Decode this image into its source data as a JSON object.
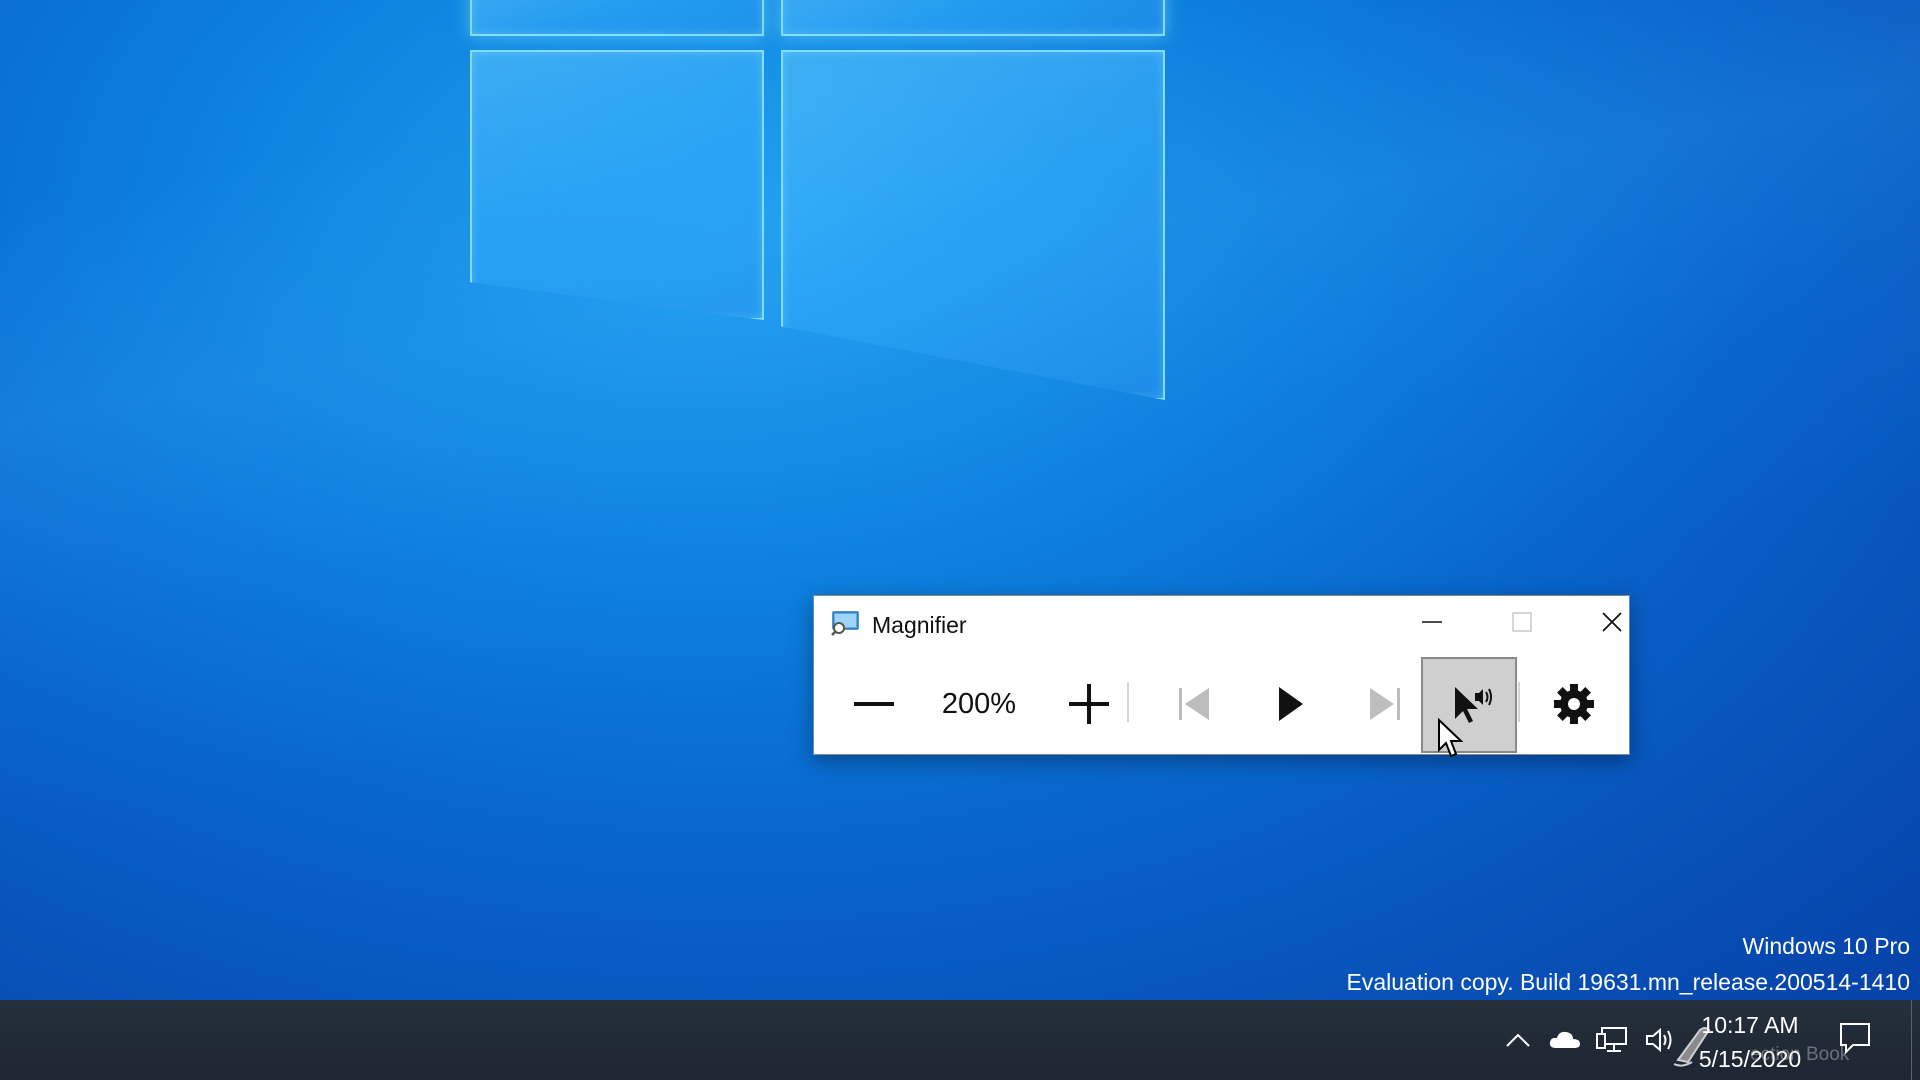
{
  "desktop": {
    "watermark_edition": "Windows 10 Pro",
    "watermark_build": "Evaluation copy. Build 19631.mn_release.200514-1410"
  },
  "magnifier": {
    "title": "Magnifier",
    "zoom_level": "200%",
    "buttons": {
      "zoom_out": "zoom-out-icon",
      "zoom_in": "zoom-in-icon",
      "previous": "skip-back-icon",
      "play": "play-icon",
      "next": "skip-forward-icon",
      "read_from_cursor": "read-from-cursor-icon",
      "settings": "gear-icon"
    },
    "active_button": "read_from_cursor"
  },
  "taskbar": {
    "time": "10:17 AM",
    "date": "5/15/2020",
    "overlay_text": "ection Book",
    "tray_icons": [
      "chevron-up-icon",
      "cloud-icon",
      "network-icon",
      "speaker-icon",
      "pen-icon",
      "notification-icon"
    ]
  },
  "colors": {
    "desktop_accent": "#0b7ddc",
    "taskbar": "#1f2937",
    "active_button_bg": "#cfcfcf"
  }
}
